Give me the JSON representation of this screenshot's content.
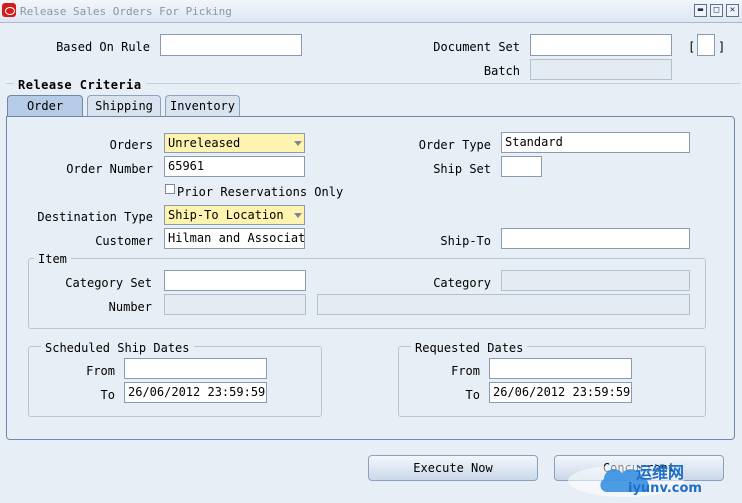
{
  "window": {
    "title": "Release Sales Orders For Picking",
    "btn_min": "▬",
    "btn_max": "□",
    "btn_close": "✕"
  },
  "header": {
    "based_on_rule_label": "Based On Rule",
    "based_on_rule_value": "",
    "document_set_label": "Document Set",
    "document_set_value": "",
    "batch_label": "Batch",
    "batch_value": "",
    "bracket_left": "[",
    "bracket_right": "]"
  },
  "release_criteria": {
    "title": "Release Criteria"
  },
  "tabs": [
    {
      "label": "Order",
      "active": true
    },
    {
      "label": "Shipping",
      "active": false
    },
    {
      "label": "Inventory",
      "active": false
    }
  ],
  "order_tab": {
    "orders_label": "Orders",
    "orders_value": "Unreleased",
    "order_type_label": "Order Type",
    "order_type_value": "Standard",
    "order_number_label": "Order Number",
    "order_number_value": "65961",
    "ship_set_label": "Ship Set",
    "ship_set_value": "",
    "prior_reservations_label": "Prior Reservations Only",
    "destination_type_label": "Destination Type",
    "destination_type_value": "Ship-To Location",
    "customer_label": "Customer",
    "customer_value": "Hilman and Associate",
    "ship_to_label": "Ship-To",
    "ship_to_value": ""
  },
  "item": {
    "title": "Item",
    "category_set_label": "Category Set",
    "category_set_value": "",
    "category_label": "Category",
    "category_value": "",
    "number_label": "Number",
    "number_value": "",
    "description_value": ""
  },
  "scheduled_ship_dates": {
    "title": "Scheduled Ship Dates",
    "from_label": "From",
    "from_value": "",
    "to_label": "To",
    "to_value": "26/06/2012 23:59:59"
  },
  "requested_dates": {
    "title": "Requested Dates",
    "from_label": "From",
    "from_value": "",
    "to_label": "To",
    "to_value": "26/06/2012 23:59:59"
  },
  "buttons": {
    "execute_now": "Execute Now",
    "concurrent": "Concurrent"
  },
  "watermark": {
    "text_cn": "运维网",
    "text_url": "iyunv.com"
  },
  "colors": {
    "required_field": "#fff3b0",
    "background": "#e8eef6",
    "active_tab": "#b6cbe5"
  }
}
